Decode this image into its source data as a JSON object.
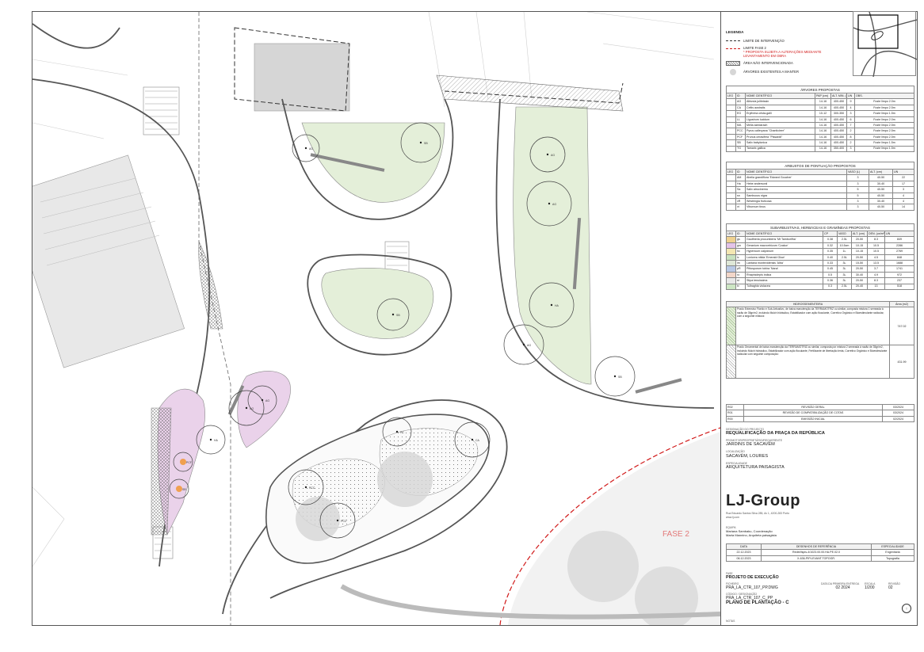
{
  "plan": {
    "fase2_label": "FASE 2",
    "tree_codes": [
      "AG",
      "SB",
      "AG",
      "AG",
      "HA",
      "AG",
      "SB",
      "SB",
      "AG",
      "HA",
      "AG",
      "PC",
      "CA",
      "PCC",
      "PCC",
      "PCF",
      "SB"
    ]
  },
  "legend": {
    "title": "LEGENDA",
    "items": [
      {
        "label": "LIMITE DE INTERVENÇÃO"
      },
      {
        "label": "LIMITE FASE 2",
        "note": "* PROPOSTA SUJEITA A ALTERAÇÕES MEDIANTE LEVANTAMENTO EM OBRA"
      },
      {
        "label": "ÁREA NÃO INTERVENCIONADA"
      },
      {
        "label": "ÁRVORES EXISTENTES A MANTER"
      }
    ]
  },
  "trees_table": {
    "title": "ÁRVORES PROPOSTAS",
    "headers": [
      "LEG",
      "ID",
      "NOME CIENTÍFICO",
      "PAP (cm)",
      "ALT. MIN. (cm)",
      "UN",
      "OBS."
    ],
    "rows": [
      [
        "",
        "AG",
        "Albizzia julibrissin",
        "14-16",
        "400-450",
        "9",
        "Fuste limpo 2.0m"
      ],
      [
        "",
        "CA",
        "Celtis australis",
        "14-16",
        "400-450",
        "4",
        "Fuste limpo 2.5m"
      ],
      [
        "",
        "EG",
        "Erythrina crista-galli",
        "10-12",
        "300-350",
        "3",
        "Fuste limpo 1.5m"
      ],
      [
        "",
        "LL",
        "Ligustrum lucidum",
        "14-16",
        "400-450",
        "6",
        "Fuste limpo 2.0m"
      ],
      [
        "",
        "MA",
        "Melia azedarach",
        "14-16",
        "400-450",
        "7",
        "Fuste limpo 2.5m"
      ],
      [
        "",
        "PCC",
        "Pyrus calleryana \"Chanticleer\"",
        "14-16",
        "400-450",
        "2",
        "Fuste limpo 2.5m"
      ],
      [
        "",
        "PCF",
        "Prunus cerasifera \"Pissardii\"",
        "14-16",
        "400-450",
        "8",
        "Fuste limpo 2.5m"
      ],
      [
        "",
        "SB",
        "Salix babylonica",
        "14-16",
        "400-450",
        "2",
        "Fuste limpo 1.5m"
      ],
      [
        "",
        "TG",
        "Tamarix gallica",
        "14-16",
        "350-400",
        "3",
        "Fuste limpo 1.5m"
      ]
    ]
  },
  "shrubs_table": {
    "title": "ARBUSTOS DE PONTUAÇÃO PROPOSTOS",
    "headers": [
      "LEG",
      "ID",
      "NOME CIENTÍFICO",
      "VASO (L)",
      "ALT. (cm)",
      "UN"
    ],
    "rows": [
      [
        "",
        "AM",
        "Abelia grandiflora 'Edward Goucher'",
        "3",
        "40-50",
        "22"
      ],
      [
        "",
        "Ha",
        "Hebe andersonii",
        "3",
        "30-40",
        "17"
      ],
      [
        "",
        "Sa",
        "Salix atrocinerea",
        "5",
        "40-50",
        "3"
      ],
      [
        "",
        "sn",
        "Sambucus nigra",
        "5",
        "40-50",
        "4"
      ],
      [
        "",
        "vR",
        "Westringia fruticosa",
        "3",
        "30-40",
        "4"
      ],
      [
        "",
        "vt",
        "Viburnum tinus",
        "3",
        "40-50",
        "14"
      ]
    ]
  },
  "herbs_table": {
    "title": "SUBARBUSTIVAS, HERBÁCEAS E GRAMÍNEAS PROPOSTAS",
    "headers": [
      "LEG",
      "ID",
      "NOME CIENTÍFICO",
      "CP",
      "VASO",
      "ALT. (cm)",
      "DEN. (un/m²)",
      "UN"
    ],
    "rows": [
      [
        "",
        "gs",
        "Gaultheria procumbens 'Mt Tamborifha'",
        "0.38",
        "2.5L",
        "20-50",
        "8.3",
        "849"
      ],
      [
        "",
        "gm",
        "Geranium macrorrhizum 'Czakor'",
        "0.32",
        "10.5cm",
        "10-15",
        "10.5",
        "2286"
      ],
      [
        "",
        "hc",
        "Hypericum calycinum",
        "0.35",
        "1L",
        "10-15",
        "10.5",
        "2769"
      ],
      [
        "",
        "lc",
        "Lonicera nitida 'Emerald Glow'",
        "0.40",
        "2.5L",
        "20-50",
        "4.5",
        "848"
      ],
      [
        "",
        "lm",
        "Lantana montevidensis 'Alba'",
        "0.33",
        "3L",
        "15-50",
        "13.5",
        "1688"
      ],
      [
        "",
        "pR",
        "Pittosporum tobira 'Nana'",
        "0.45",
        "3L",
        "20-50",
        "3.7",
        "1741"
      ],
      [
        "",
        "ro",
        "Rhaphiolepis indica",
        "0.5",
        "3L",
        "30-40",
        "4.9",
        "972"
      ],
      [
        "",
        "st",
        "Stipa tenuissima",
        "0.36",
        "3L",
        "20-50",
        "8.3",
        "237"
      ],
      [
        "",
        "tv",
        "Tulbaghia violacea",
        "0.3",
        "2.5L",
        "20-40",
        "13",
        "518"
      ]
    ]
  },
  "hydro": {
    "title": "HIDROSSEMENTEIRA",
    "area_header": "Área (m2)",
    "rows": [
      {
        "text": "Prado Extensivo Florido e Sub-Arbustivo, de baixa manutenção da TERRAMOTRIZ ou similar, composta mistura 1 semeada à razão de 35gr/m2, incluindo Mulch hidráulico, Estabilizador com ação floculante, Corretivo Orgânico e Bioestimulante radicular, com a seguinte mistura:",
        "area": "747.02"
      },
      {
        "text": "Prado Ornamental de baixa manutenção da TERRAMOTRIZ ou similar, composta por mistura 2 semeada à razão de 35gr/m2, incluindo Mulch hidráulico, Estabilizador com ação floculante, Fertilizante de libertação lenta, Corretivo Orgânico e Bioestimulante radicular com seguinte composição:",
        "area": "431.99"
      }
    ]
  },
  "revisions": [
    {
      "code": "R02",
      "desc": "REVISÃO GERAL",
      "date": "03/2024"
    },
    {
      "code": "R01",
      "desc": "REVISÃO DE COMPATIBILIZAÇÃO DE COTAS",
      "date": "03/2024"
    },
    {
      "code": "R00",
      "desc": "EMISSÃO INICIAL",
      "date": "02/2024"
    }
  ],
  "project": {
    "designation_label": "DESIGNAÇÃO DO PROJECTO",
    "designation": "REQUALIFICAÇÃO DA PRAÇA DA REPÚBLICA",
    "owner_label": "PROMOTOR/PROPRIETÁRIO/REQUERENTE",
    "owner": "JARDINS DE SACAVÉM",
    "location_label": "LOCALIZAÇÃO",
    "location": "SACAVÉM, LOURES",
    "specialty_label": "ESPECIALIDADE",
    "specialty": "ARQUITETURA PAISAGISTA",
    "company": "LJ-Group",
    "company_address": "Rua Eduardo Santos Silva 285, Av 1, 4200-283 Porto",
    "company_web": "www.lj.com",
    "team_label": "EQUIPA",
    "team": [
      "Mariana Sambaku, Coordenação",
      "Marta Mannino, Arquiteta paisagista"
    ]
  },
  "references": {
    "headers": [
      "DATA",
      "DESENHOS DE REFERÊNCIA",
      "ESPECIALIDADE"
    ],
    "rows": [
      [
        "22.12.2023",
        "Redet/Ispis-4/1023.00.00.HA.PE.02.0",
        "Engenharia"
      ],
      [
        "06.12.2023",
        "X-636-PIP.LEVANT.TOPOGR.",
        "Topografia"
      ]
    ]
  },
  "drawing": {
    "phase_label": "FASE",
    "phase": "PROJETO DE EXECUÇÃO",
    "file_label": "FICHEIRO",
    "file": "PRA_LA_CTR_107_PP.DWG",
    "first_date_label": "DATA DA PRIMEIRA ENTREGA",
    "first_date": "02 2024",
    "scale_label": "ESCALA",
    "scale": "1/200",
    "revision_label": "REVISÃO",
    "revision": "02",
    "code_label": "CÓDIGO / DESIGNAÇÃO",
    "code": "PRA_LA_CTR_107_C_PP",
    "title": "PLANO DE PLANTAÇÃO - C",
    "notes_label": "NOTAS"
  },
  "colors": {
    "grass": "#e4efd9",
    "pink": "#ead2ea",
    "road": "#555555",
    "red_dash": "#d11a1a",
    "grey_fill": "#d6d6d6"
  }
}
